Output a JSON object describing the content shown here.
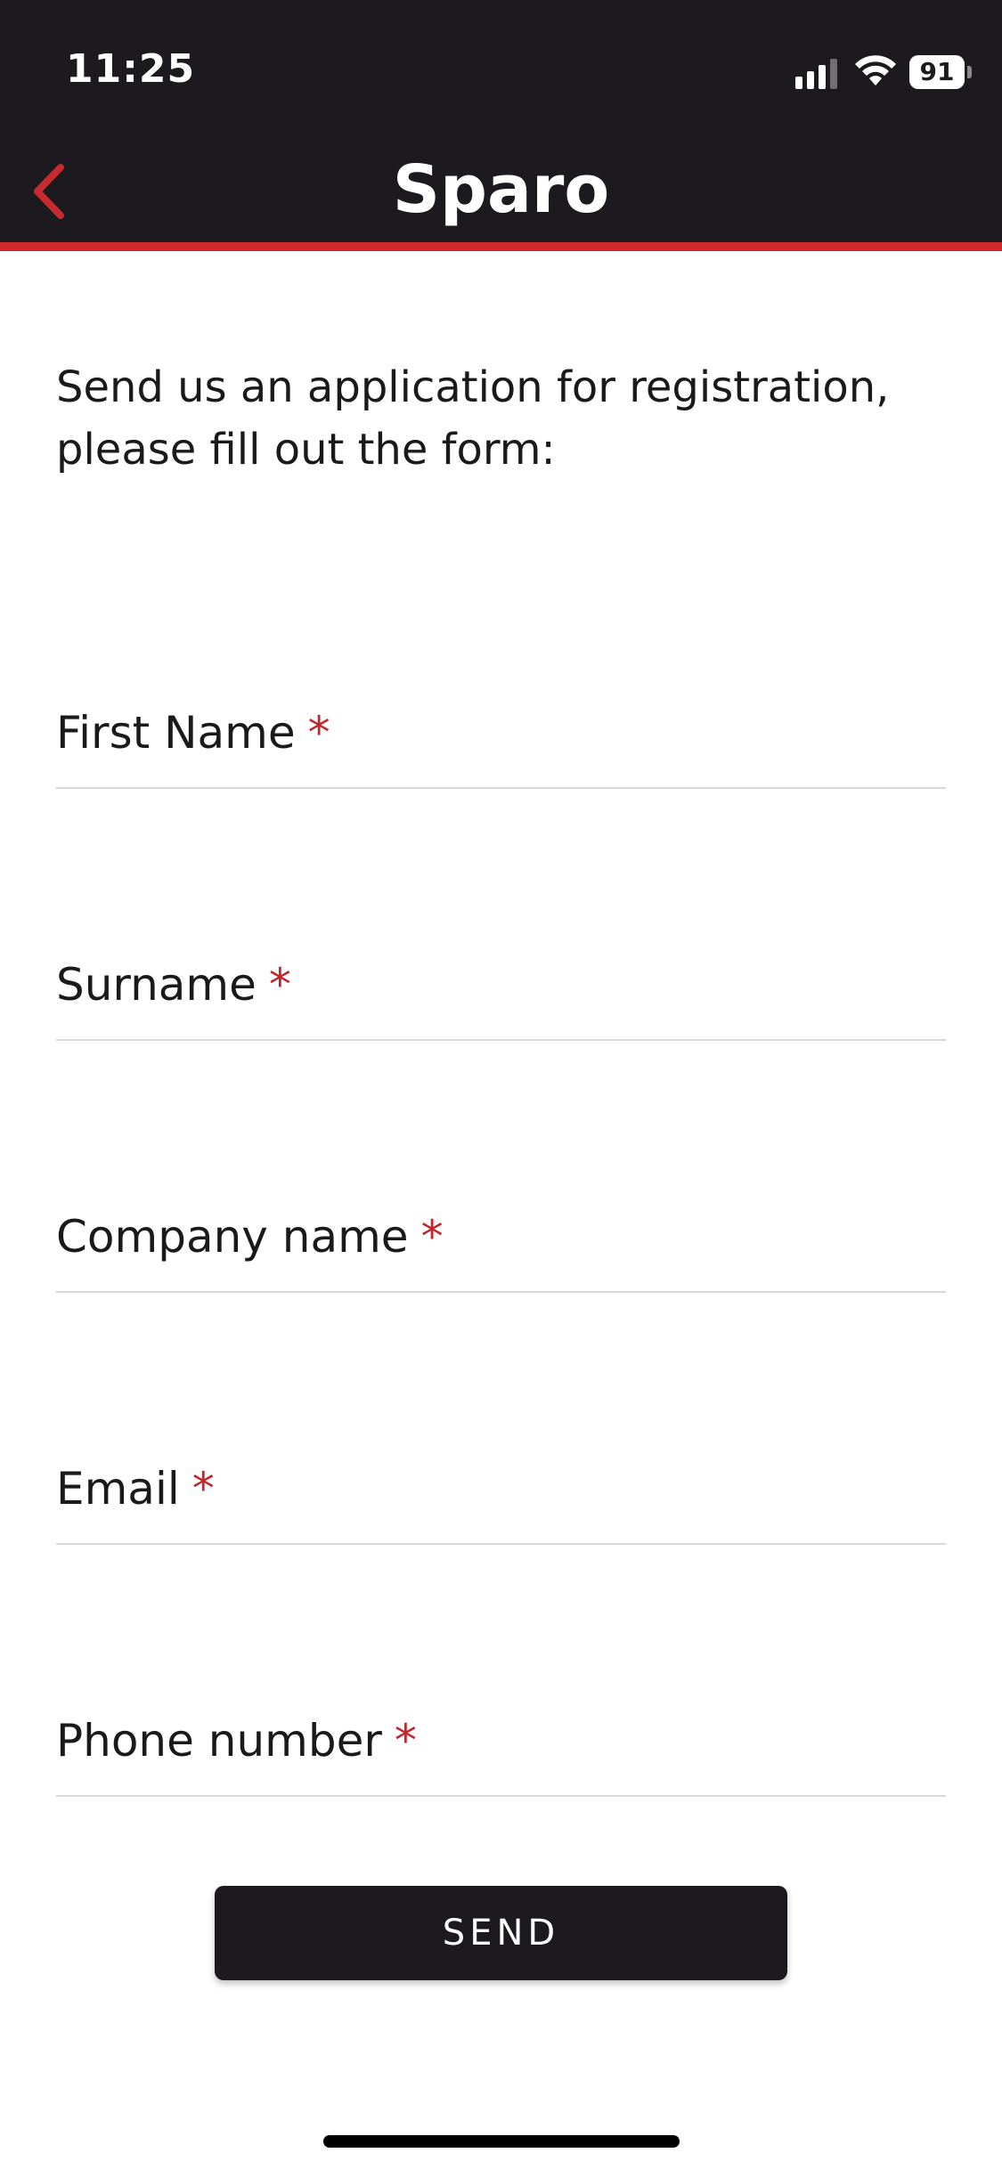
{
  "status_bar": {
    "time": "11:25",
    "battery_level": "91",
    "icons": [
      "signal-icon",
      "wifi-icon",
      "battery-icon"
    ]
  },
  "nav": {
    "title": "Sparo",
    "back_icon": "chevron-left-icon"
  },
  "intro_text": "Send us an application for registration, please fill out the form:",
  "form": {
    "fields": [
      {
        "label": "First Name",
        "required_mark": "*"
      },
      {
        "label": "Surname",
        "required_mark": "*"
      },
      {
        "label": "Company name",
        "required_mark": "*"
      },
      {
        "label": "Email",
        "required_mark": "*"
      },
      {
        "label": "Phone number",
        "required_mark": "*"
      }
    ],
    "submit_label": "SEND"
  },
  "colors": {
    "header_bg": "#1c1a1f",
    "accent": "#d0282d",
    "required": "#c0262c",
    "button_bg": "#1c1a1f"
  }
}
